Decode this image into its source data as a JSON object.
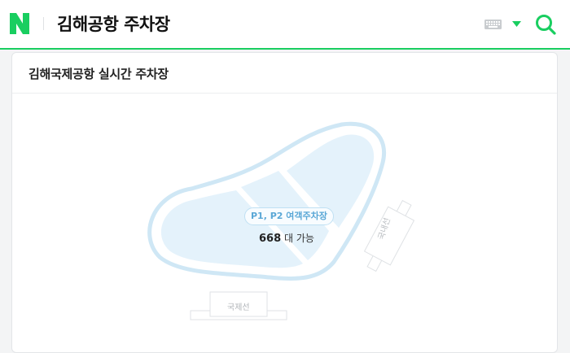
{
  "header": {
    "title": "김해공항 주차장",
    "logo_icon": "naver-n-logo",
    "keyboard_icon": "keyboard-icon",
    "dropdown_icon": "caret-down-icon",
    "search_icon": "search-icon",
    "accent_color": "#19ce60"
  },
  "card": {
    "title": "김해국제공항 실시간 주차장"
  },
  "map": {
    "lot_name": "P1, P2 여객주차장",
    "available_count": "668",
    "available_suffix": "대 가능",
    "domestic_terminal": "국내선",
    "international_terminal": "국제선",
    "lot_fill_color": "#e4f2fb",
    "lot_border_color": "#cfe7f5"
  }
}
